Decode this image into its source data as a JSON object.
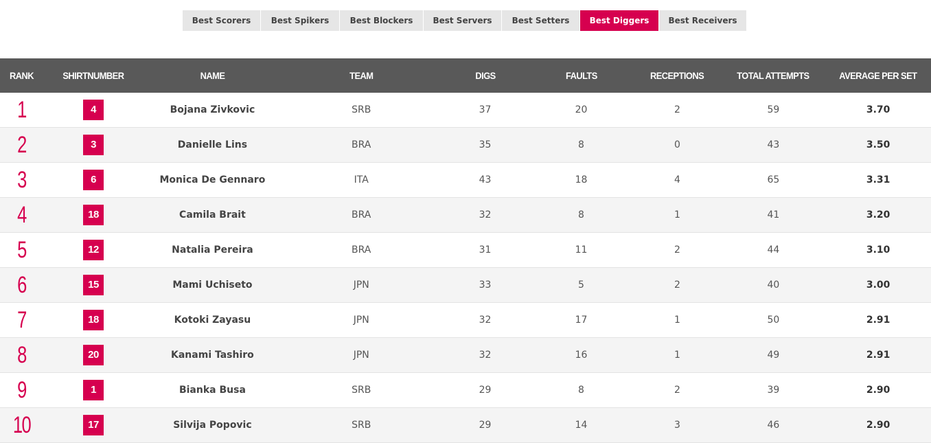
{
  "tabs": [
    {
      "label": "Best Scorers",
      "active": false
    },
    {
      "label": "Best Spikers",
      "active": false
    },
    {
      "label": "Best Blockers",
      "active": false
    },
    {
      "label": "Best Servers",
      "active": false
    },
    {
      "label": "Best Setters",
      "active": false
    },
    {
      "label": "Best Diggers",
      "active": true
    },
    {
      "label": "Best Receivers",
      "active": false
    }
  ],
  "table": {
    "headers": {
      "rank": "RANK",
      "shirt": "SHIRTNUMBER",
      "name": "NAME",
      "team": "TEAM",
      "digs": "DIGS",
      "faults": "FAULTS",
      "receptions": "RECEPTIONS",
      "total": "TOTAL ATTEMPTS",
      "avg": "AVERAGE PER SET"
    },
    "rows": [
      {
        "rank": "1",
        "shirt": "4",
        "name": "Bojana Zivkovic",
        "team": "SRB",
        "digs": "37",
        "faults": "20",
        "receptions": "2",
        "total": "59",
        "avg": "3.70"
      },
      {
        "rank": "2",
        "shirt": "3",
        "name": "Danielle Lins",
        "team": "BRA",
        "digs": "35",
        "faults": "8",
        "receptions": "0",
        "total": "43",
        "avg": "3.50"
      },
      {
        "rank": "3",
        "shirt": "6",
        "name": "Monica De Gennaro",
        "team": "ITA",
        "digs": "43",
        "faults": "18",
        "receptions": "4",
        "total": "65",
        "avg": "3.31"
      },
      {
        "rank": "4",
        "shirt": "18",
        "name": "Camila Brait",
        "team": "BRA",
        "digs": "32",
        "faults": "8",
        "receptions": "1",
        "total": "41",
        "avg": "3.20"
      },
      {
        "rank": "5",
        "shirt": "12",
        "name": "Natalia Pereira",
        "team": "BRA",
        "digs": "31",
        "faults": "11",
        "receptions": "2",
        "total": "44",
        "avg": "3.10"
      },
      {
        "rank": "6",
        "shirt": "15",
        "name": "Mami Uchiseto",
        "team": "JPN",
        "digs": "33",
        "faults": "5",
        "receptions": "2",
        "total": "40",
        "avg": "3.00"
      },
      {
        "rank": "7",
        "shirt": "18",
        "name": "Kotoki Zayasu",
        "team": "JPN",
        "digs": "32",
        "faults": "17",
        "receptions": "1",
        "total": "50",
        "avg": "2.91"
      },
      {
        "rank": "8",
        "shirt": "20",
        "name": "Kanami Tashiro",
        "team": "JPN",
        "digs": "32",
        "faults": "16",
        "receptions": "1",
        "total": "49",
        "avg": "2.91"
      },
      {
        "rank": "9",
        "shirt": "1",
        "name": "Bianka Busa",
        "team": "SRB",
        "digs": "29",
        "faults": "8",
        "receptions": "2",
        "total": "39",
        "avg": "2.90"
      },
      {
        "rank": "10",
        "shirt": "17",
        "name": "Silvija Popovic",
        "team": "SRB",
        "digs": "29",
        "faults": "14",
        "receptions": "3",
        "total": "46",
        "avg": "2.90"
      }
    ]
  },
  "colors": {
    "accent": "#d6004f",
    "header_bg": "#595959",
    "tab_bg": "#e6e6e6"
  }
}
